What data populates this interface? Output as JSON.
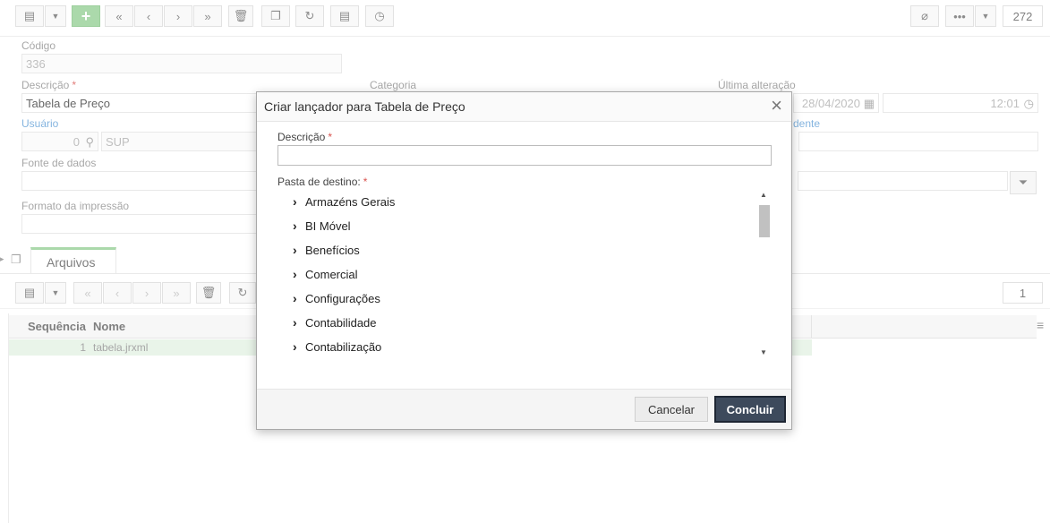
{
  "toolbar": {
    "counter": "272"
  },
  "form": {
    "codigo_label": "Código",
    "codigo_value": "336",
    "descricao_label": "Descrição",
    "descricao_value": "Tabela de Preço",
    "categoria_label": "Categoria",
    "ultima_alteracao_label": "Última alteração",
    "ultima_alteracao_date": "28/04/2020",
    "ultima_alteracao_time": "12:01",
    "usuario_label": "Usuário",
    "usuario_id": "0",
    "usuario_name": "SUP",
    "right_label_partial": "dente",
    "fonte_label": "Fonte de dados",
    "formato_label": "Formato da impressão",
    "required_mark": "*"
  },
  "tabs": {
    "arquivos": "Arquivos"
  },
  "grid": {
    "counter": "1",
    "columns": [
      "Sequência",
      "Nome"
    ],
    "rows": [
      {
        "seq": "1",
        "nome": "tabela.jrxml"
      }
    ]
  },
  "modal": {
    "title": "Criar lançador para Tabela de Preço",
    "descricao_label": "Descrição",
    "descricao_value": "",
    "pasta_label": "Pasta de destino:",
    "required_mark": "*",
    "folders": [
      "Armazéns Gerais",
      "BI Móvel",
      "Benefícios",
      "Comercial",
      "Configurações",
      "Contabilidade",
      "Contabilização"
    ],
    "cancel_label": "Cancelar",
    "confirm_label": "Concluir"
  },
  "colors": {
    "accent_green": "#8fcc8f",
    "primary_button": "#3d4a5c",
    "label_blue": "#5b9bd5",
    "required_red": "#d9534f"
  }
}
